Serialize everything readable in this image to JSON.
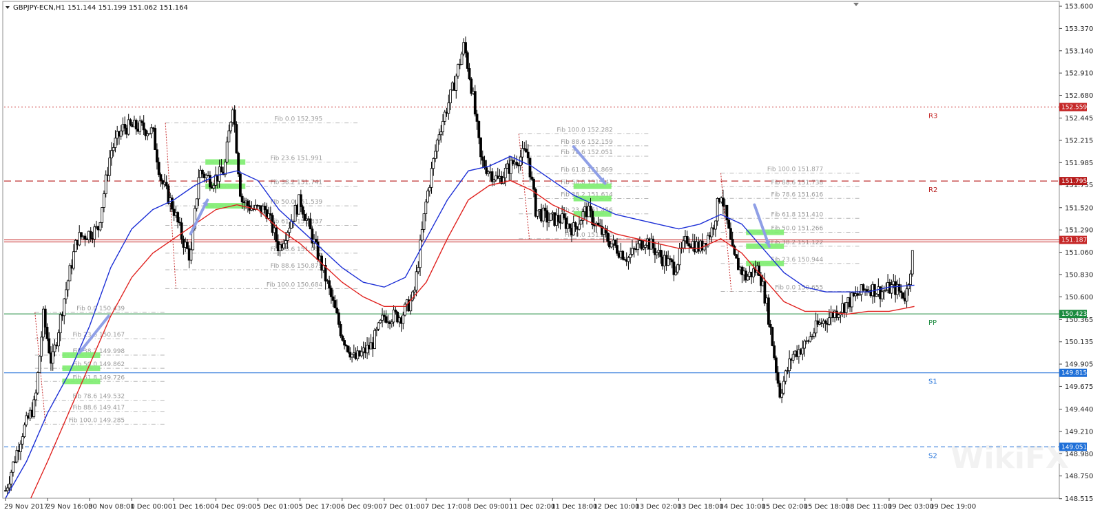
{
  "window": {
    "symbol_line": "GBPJPY-ECN,H1  151.144 151.199 151.062 151.164"
  },
  "chart_data": {
    "type": "candlestick",
    "ylim": [
      148.52,
      153.65
    ],
    "y_ticks": [
      "153.600",
      "153.370",
      "153.140",
      "152.910",
      "152.680",
      "152.445",
      "152.215",
      "151.985",
      "151.755",
      "151.520",
      "151.290",
      "151.060",
      "150.830",
      "150.600",
      "150.365",
      "150.135",
      "149.905",
      "149.675",
      "149.440",
      "149.210",
      "148.980",
      "148.750",
      "148.515"
    ],
    "x_ticks": [
      "29 Nov 2017",
      "29 Nov 16:00",
      "30 Nov 08:00",
      "1 Dec 00:00",
      "1 Dec 16:00",
      "4 Dec 09:00",
      "5 Dec 01:00",
      "5 Dec 17:00",
      "6 Dec 09:00",
      "7 Dec 01:00",
      "7 Dec 17:00",
      "8 Dec 09:00",
      "11 Dec 02:00",
      "11 Dec 18:00",
      "12 Dec 10:00",
      "13 Dec 02:00",
      "13 Dec 18:00",
      "14 Dec 10:00",
      "15 Dec 02:00",
      "15 Dec 18:00",
      "18 Dec 11:00",
      "19 Dec 03:00",
      "19 Dec 19:00"
    ],
    "x_count": 22,
    "close_path": [
      [
        0,
        148.6
      ],
      [
        0.4,
        149.2
      ],
      [
        0.7,
        149.5
      ],
      [
        0.9,
        150.4
      ],
      [
        1.1,
        149.9
      ],
      [
        1.4,
        150.6
      ],
      [
        1.7,
        151.2
      ],
      [
        2.2,
        151.3
      ],
      [
        2.5,
        152.1
      ],
      [
        2.8,
        152.35
      ],
      [
        3.2,
        152.35
      ],
      [
        3.5,
        152.3
      ],
      [
        3.7,
        151.8
      ],
      [
        4.0,
        151.5
      ],
      [
        4.2,
        151.2
      ],
      [
        4.4,
        151.0
      ],
      [
        4.6,
        151.9
      ],
      [
        4.9,
        151.8
      ],
      [
        5.2,
        151.9
      ],
      [
        5.4,
        152.6
      ],
      [
        5.6,
        151.6
      ],
      [
        5.9,
        151.5
      ],
      [
        6.2,
        151.5
      ],
      [
        6.5,
        151.1
      ],
      [
        6.8,
        151.4
      ],
      [
        7.0,
        151.6
      ],
      [
        7.3,
        151.2
      ],
      [
        7.6,
        150.8
      ],
      [
        8.0,
        150.2
      ],
      [
        8.3,
        149.95
      ],
      [
        8.7,
        150.1
      ],
      [
        9.0,
        150.4
      ],
      [
        9.4,
        150.4
      ],
      [
        9.7,
        150.6
      ],
      [
        10.0,
        151.6
      ],
      [
        10.3,
        152.3
      ],
      [
        10.6,
        152.7
      ],
      [
        10.9,
        153.2
      ],
      [
        11.1,
        152.7
      ],
      [
        11.3,
        152.0
      ],
      [
        11.7,
        151.8
      ],
      [
        12.1,
        152.0
      ],
      [
        12.4,
        152.1
      ],
      [
        12.6,
        151.5
      ],
      [
        12.9,
        151.4
      ],
      [
        13.2,
        151.4
      ],
      [
        13.5,
        151.3
      ],
      [
        13.8,
        151.5
      ],
      [
        14.1,
        151.3
      ],
      [
        14.4,
        151.15
      ],
      [
        14.8,
        151.0
      ],
      [
        15.2,
        151.2
      ],
      [
        15.6,
        151.0
      ],
      [
        15.9,
        150.9
      ],
      [
        16.2,
        151.2
      ],
      [
        16.5,
        151.1
      ],
      [
        16.8,
        151.3
      ],
      [
        17.0,
        151.7
      ],
      [
        17.3,
        151.0
      ],
      [
        17.6,
        150.8
      ],
      [
        17.9,
        150.9
      ],
      [
        18.1,
        150.5
      ],
      [
        18.4,
        149.6
      ],
      [
        18.7,
        150.0
      ],
      [
        19.0,
        150.1
      ],
      [
        19.3,
        150.3
      ],
      [
        19.6,
        150.4
      ],
      [
        19.9,
        150.5
      ],
      [
        20.2,
        150.6
      ],
      [
        20.5,
        150.7
      ],
      [
        20.8,
        150.65
      ],
      [
        21.1,
        150.7
      ],
      [
        21.4,
        150.6
      ],
      [
        21.6,
        151.16
      ]
    ],
    "ma_blue": [
      [
        0,
        148.52
      ],
      [
        0.5,
        148.9
      ],
      [
        1.0,
        149.4
      ],
      [
        1.5,
        149.8
      ],
      [
        2.0,
        150.3
      ],
      [
        2.5,
        150.9
      ],
      [
        3.0,
        151.3
      ],
      [
        3.5,
        151.5
      ],
      [
        4.0,
        151.6
      ],
      [
        4.5,
        151.75
      ],
      [
        5.0,
        151.85
      ],
      [
        5.5,
        151.9
      ],
      [
        6.0,
        151.8
      ],
      [
        6.5,
        151.5
      ],
      [
        7.0,
        151.3
      ],
      [
        7.5,
        151.1
      ],
      [
        8.0,
        150.9
      ],
      [
        8.5,
        150.75
      ],
      [
        9.0,
        150.7
      ],
      [
        9.5,
        150.8
      ],
      [
        10.0,
        151.2
      ],
      [
        10.5,
        151.6
      ],
      [
        11.0,
        151.9
      ],
      [
        11.5,
        151.95
      ],
      [
        12.0,
        152.05
      ],
      [
        12.5,
        151.95
      ],
      [
        13.0,
        151.8
      ],
      [
        13.5,
        151.65
      ],
      [
        14.0,
        151.55
      ],
      [
        14.5,
        151.45
      ],
      [
        15.0,
        151.4
      ],
      [
        15.5,
        151.35
      ],
      [
        16.0,
        151.3
      ],
      [
        16.5,
        151.35
      ],
      [
        17.0,
        151.45
      ],
      [
        17.5,
        151.35
      ],
      [
        18.0,
        151.1
      ],
      [
        18.5,
        150.85
      ],
      [
        19.0,
        150.7
      ],
      [
        19.5,
        150.65
      ],
      [
        20.0,
        150.65
      ],
      [
        20.5,
        150.65
      ],
      [
        21.0,
        150.7
      ],
      [
        21.6,
        150.72
      ]
    ],
    "ma_red": [
      [
        0.6,
        148.52
      ],
      [
        1.0,
        148.9
      ],
      [
        1.5,
        149.4
      ],
      [
        2.0,
        149.9
      ],
      [
        2.5,
        150.4
      ],
      [
        3.0,
        150.8
      ],
      [
        3.5,
        151.05
      ],
      [
        4.0,
        151.2
      ],
      [
        4.5,
        151.35
      ],
      [
        5.0,
        151.5
      ],
      [
        5.5,
        151.55
      ],
      [
        6.0,
        151.5
      ],
      [
        6.5,
        151.3
      ],
      [
        7.0,
        151.15
      ],
      [
        7.5,
        150.95
      ],
      [
        8.0,
        150.75
      ],
      [
        8.5,
        150.6
      ],
      [
        9.0,
        150.5
      ],
      [
        9.5,
        150.5
      ],
      [
        10.0,
        150.75
      ],
      [
        10.5,
        151.2
      ],
      [
        11.0,
        151.6
      ],
      [
        11.5,
        151.75
      ],
      [
        12.0,
        151.8
      ],
      [
        12.5,
        151.7
      ],
      [
        13.0,
        151.55
      ],
      [
        13.5,
        151.45
      ],
      [
        14.0,
        151.35
      ],
      [
        14.5,
        151.25
      ],
      [
        15.0,
        151.2
      ],
      [
        15.5,
        151.15
      ],
      [
        16.0,
        151.1
      ],
      [
        16.5,
        151.1
      ],
      [
        17.0,
        151.2
      ],
      [
        17.5,
        151.05
      ],
      [
        18.0,
        150.8
      ],
      [
        18.5,
        150.55
      ],
      [
        19.0,
        150.45
      ],
      [
        19.5,
        150.45
      ],
      [
        20.0,
        150.42
      ],
      [
        20.5,
        150.45
      ],
      [
        21.0,
        150.45
      ],
      [
        21.6,
        150.5
      ]
    ],
    "pivots": [
      {
        "name": "R3",
        "value": 152.559,
        "tag": "152.559",
        "color": "#c62828",
        "style": "dotted"
      },
      {
        "name": "R2",
        "value": 151.795,
        "tag": "151.795",
        "color": "#b71c1c",
        "style": "dashed"
      },
      {
        "name": "",
        "value": 151.187,
        "tag": "151.187",
        "color": "#c62828",
        "style": "double"
      },
      {
        "name": "PP",
        "value": 150.423,
        "tag": "150.423",
        "color": "#1b8a3e",
        "style": "solid"
      },
      {
        "name": "S1",
        "value": 149.815,
        "tag": "149.815",
        "color": "#1e6fd8",
        "style": "solid"
      },
      {
        "name": "S2",
        "value": 149.051,
        "tag": "149.051",
        "color": "#1e6fd8",
        "style": "dashed"
      }
    ],
    "fib_sets": [
      {
        "label_x": 2.9,
        "x1": 0.7,
        "x2": 3.0,
        "levels": [
          {
            "text": "Fib 0.0   150.439",
            "v": 150.439
          },
          {
            "text": "Fib 23.6  150.167",
            "v": 150.167
          },
          {
            "text": "Fib 38.2  149.998",
            "v": 149.998
          },
          {
            "text": "Fib 50.0  149.862",
            "v": 149.862
          },
          {
            "text": "Fib 61.8  149.726",
            "v": 149.726
          },
          {
            "text": "Fib 78.6  149.532",
            "v": 149.532
          },
          {
            "text": "Fib 88.6  149.417",
            "v": 149.417
          },
          {
            "text": "Fib 100.0  149.285",
            "v": 149.285
          }
        ]
      },
      {
        "label_x": 7.6,
        "x1": 3.8,
        "x2": 7.6,
        "levels": [
          {
            "text": "Fib 0.0   152.395",
            "v": 152.395
          },
          {
            "text": "Fib 23.6  151.991",
            "v": 151.991
          },
          {
            "text": "Fib 38.2  151.741",
            "v": 151.741
          },
          {
            "text": "Fib 50.0  151.539",
            "v": 151.539
          },
          {
            "text": "Fib 61.8  151.337",
            "v": 151.337
          },
          {
            "text": "Fib 78.6  151.050",
            "v": 151.05
          },
          {
            "text": "Fib 88.6  150.879",
            "v": 150.879
          },
          {
            "text": "Fib 100.0  150.684",
            "v": 150.684
          }
        ]
      },
      {
        "label_x": 14.5,
        "x1": 12.2,
        "x2": 14.5,
        "levels": [
          {
            "text": "Fib 100.0  152.282",
            "v": 152.282
          },
          {
            "text": "Fib 88.6  152.159",
            "v": 152.159
          },
          {
            "text": "Fib 78.6  152.051",
            "v": 152.051
          },
          {
            "text": "Fib 61.8  151.869",
            "v": 151.869
          },
          {
            "text": "Fib 50.0  151.741",
            "v": 151.741
          },
          {
            "text": "Fib 38.2  151.614",
            "v": 151.614
          },
          {
            "text": "Fib 23.6  151.456",
            "v": 151.456
          },
          {
            "text": "Fib 0.0   151.200",
            "v": 151.2
          }
        ]
      },
      {
        "label_x": 19.5,
        "x1": 17.0,
        "x2": 19.5,
        "levels": [
          {
            "text": "Fib 100.0  151.877",
            "v": 151.877
          },
          {
            "text": "Fib 88.6  151.738",
            "v": 151.738
          },
          {
            "text": "Fib 78.6  151.616",
            "v": 151.616
          },
          {
            "text": "Fib 61.8  151.410",
            "v": 151.41
          },
          {
            "text": "Fib 50.0  151.266",
            "v": 151.266
          },
          {
            "text": "Fib 38.2  151.122",
            "v": 151.122
          },
          {
            "text": "Fib 23.6  150.944",
            "v": 150.944
          },
          {
            "text": "Fib 0.0   150.655",
            "v": 150.655
          }
        ]
      }
    ],
    "green_zones": [
      {
        "x1": 1.35,
        "x2": 2.25,
        "v": 149.998
      },
      {
        "x1": 1.35,
        "x2": 2.25,
        "v": 149.862
      },
      {
        "x1": 1.35,
        "x2": 2.25,
        "v": 149.726
      },
      {
        "x1": 4.75,
        "x2": 5.7,
        "v": 151.991
      },
      {
        "x1": 4.75,
        "x2": 5.7,
        "v": 151.741
      },
      {
        "x1": 4.75,
        "x2": 5.7,
        "v": 151.539
      },
      {
        "x1": 13.5,
        "x2": 14.4,
        "v": 151.741
      },
      {
        "x1": 13.5,
        "x2": 14.4,
        "v": 151.614
      },
      {
        "x1": 13.5,
        "x2": 14.4,
        "v": 151.456
      },
      {
        "x1": 17.6,
        "x2": 18.5,
        "v": 151.266
      },
      {
        "x1": 17.6,
        "x2": 18.5,
        "v": 151.122
      },
      {
        "x1": 17.6,
        "x2": 18.5,
        "v": 150.944
      }
    ],
    "arrows": [
      {
        "x1": 2.45,
        "v1": 150.4,
        "x2": 1.75,
        "v2": 150.02
      },
      {
        "x1": 4.4,
        "v1": 151.25,
        "x2": 4.8,
        "v2": 151.6
      },
      {
        "x1": 13.5,
        "v1": 152.15,
        "x2": 14.25,
        "v2": 151.77
      },
      {
        "x1": 17.8,
        "v1": 151.55,
        "x2": 18.15,
        "v2": 151.12
      }
    ],
    "watermark": "WikiFX"
  }
}
